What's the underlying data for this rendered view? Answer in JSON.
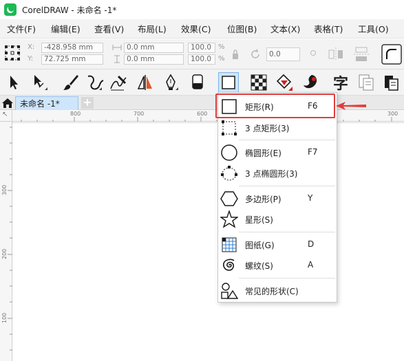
{
  "window": {
    "title": "CorelDRAW - 未命名 -1*"
  },
  "menu": {
    "items": [
      {
        "label": "文件(F)",
        "key": "F"
      },
      {
        "label": "编辑(E)",
        "key": "E"
      },
      {
        "label": "查看(V)",
        "key": "V"
      },
      {
        "label": "布局(L)",
        "key": "L"
      },
      {
        "label": "效果(C)",
        "key": "C"
      },
      {
        "label": "位图(B)",
        "key": "B"
      },
      {
        "label": "文本(X)",
        "key": "X"
      },
      {
        "label": "表格(T)",
        "key": "T"
      },
      {
        "label": "工具(O)",
        "key": "O"
      }
    ]
  },
  "property_bar": {
    "x_label": "X:",
    "y_label": "Y:",
    "x_value": "-428.958 mm",
    "y_value": "72.725 mm",
    "width_value": "0.0 mm",
    "height_value": "0.0 mm",
    "scale_x": "100.0",
    "scale_y": "100.0",
    "pct": "%",
    "rotation": "0.0"
  },
  "toolbox": {
    "tools": [
      "pick-tool",
      "shape-tool",
      "artistic-media-tool",
      "freehand-tool",
      "smart-drawing-tool",
      "parallel-dimension-tool",
      "pen-tool",
      "eraser-tool",
      "rectangle-tool",
      "checker-pattern-tool",
      "interactive-fill-tool",
      "smart-fill-tool",
      "text-tool",
      "table-tool",
      "clipboard-tool"
    ],
    "text_tool_char": "字"
  },
  "tabs": {
    "doc_tab": "未命名 -1*",
    "add": "+"
  },
  "rulers": {
    "h_labels": [
      "800",
      "700",
      "600",
      "300"
    ],
    "v_labels": [
      "300",
      "200",
      "100"
    ],
    "corner_mark": "↖"
  },
  "flyout": {
    "items": [
      {
        "label": "矩形(R)",
        "shortcut": "F6",
        "icon": "rectangle-icon"
      },
      {
        "label": "3 点矩形(3)",
        "shortcut": "",
        "icon": "three-point-rectangle-icon"
      },
      {
        "label": "椭圆形(E)",
        "shortcut": "F7",
        "icon": "ellipse-icon"
      },
      {
        "label": "3 点椭圆形(3)",
        "shortcut": "",
        "icon": "three-point-ellipse-icon"
      },
      {
        "label": "多边形(P)",
        "shortcut": "Y",
        "icon": "polygon-icon"
      },
      {
        "label": "星形(S)",
        "shortcut": "",
        "icon": "star-icon"
      },
      {
        "label": "图纸(G)",
        "shortcut": "D",
        "icon": "graph-paper-icon"
      },
      {
        "label": "螺纹(S)",
        "shortcut": "A",
        "icon": "spiral-icon"
      },
      {
        "label": "常见的形状(C)",
        "shortcut": "",
        "icon": "common-shapes-icon"
      }
    ]
  },
  "colors": {
    "highlight": "#e23b3b",
    "active_tool": "#cfe5fb"
  }
}
